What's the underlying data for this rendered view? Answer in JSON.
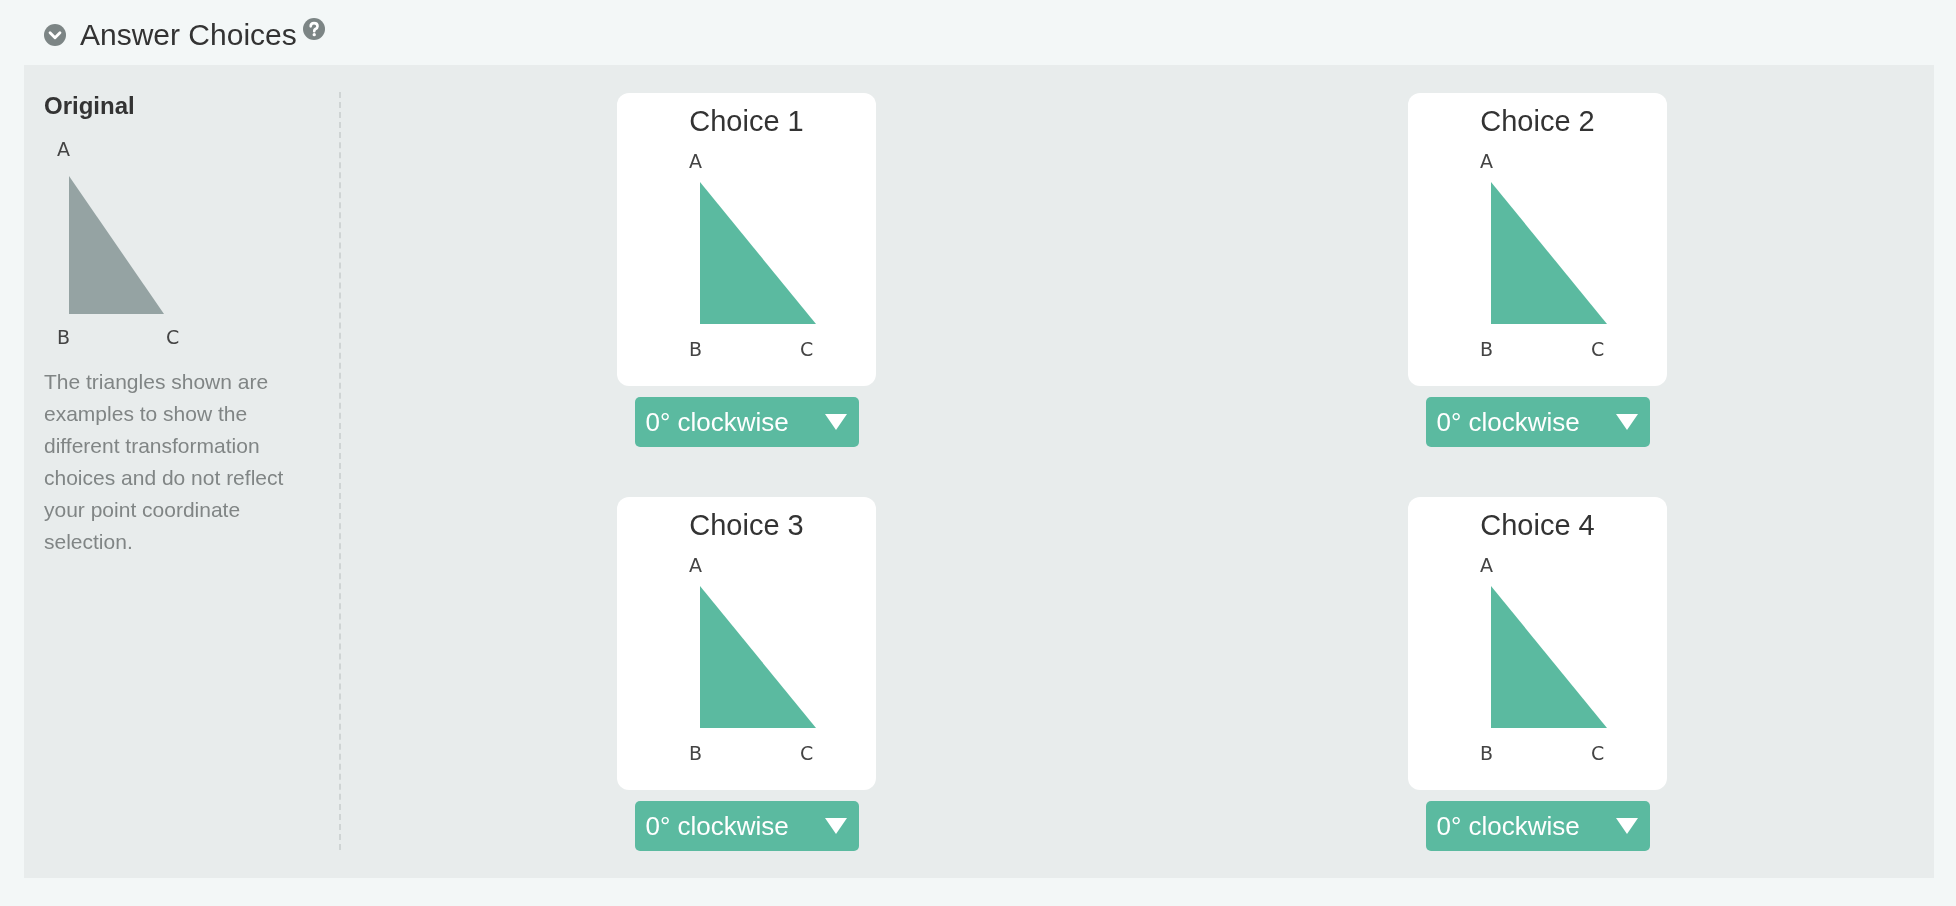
{
  "section": {
    "title": "Answer Choices",
    "expanded": true
  },
  "original": {
    "heading": "Original",
    "vertices": [
      "A",
      "B",
      "C"
    ],
    "note": "The triangles shown are examples to show the different transformation choices and do not reflect your point coordinate selection."
  },
  "choices": [
    {
      "title": "Choice 1",
      "vertices": [
        "A",
        "B",
        "C"
      ],
      "rotation": "0° clockwise"
    },
    {
      "title": "Choice 2",
      "vertices": [
        "A",
        "B",
        "C"
      ],
      "rotation": "0° clockwise"
    },
    {
      "title": "Choice 3",
      "vertices": [
        "A",
        "B",
        "C"
      ],
      "rotation": "0° clockwise"
    },
    {
      "title": "Choice 4",
      "vertices": [
        "A",
        "B",
        "C"
      ],
      "rotation": "0° clockwise"
    }
  ]
}
